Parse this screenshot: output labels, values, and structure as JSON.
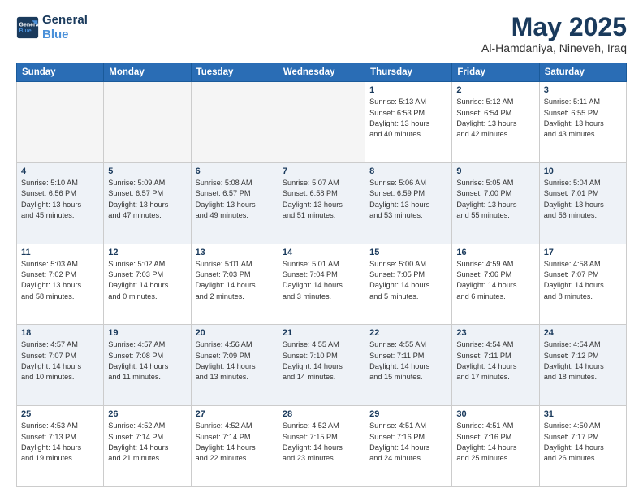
{
  "logo": {
    "line1": "General",
    "line2": "Blue"
  },
  "title": "May 2025",
  "subtitle": "Al-Hamdaniya, Nineveh, Iraq",
  "weekdays": [
    "Sunday",
    "Monday",
    "Tuesday",
    "Wednesday",
    "Thursday",
    "Friday",
    "Saturday"
  ],
  "rows": [
    [
      {
        "day": "",
        "info": ""
      },
      {
        "day": "",
        "info": ""
      },
      {
        "day": "",
        "info": ""
      },
      {
        "day": "",
        "info": ""
      },
      {
        "day": "1",
        "info": "Sunrise: 5:13 AM\nSunset: 6:53 PM\nDaylight: 13 hours\nand 40 minutes."
      },
      {
        "day": "2",
        "info": "Sunrise: 5:12 AM\nSunset: 6:54 PM\nDaylight: 13 hours\nand 42 minutes."
      },
      {
        "day": "3",
        "info": "Sunrise: 5:11 AM\nSunset: 6:55 PM\nDaylight: 13 hours\nand 43 minutes."
      }
    ],
    [
      {
        "day": "4",
        "info": "Sunrise: 5:10 AM\nSunset: 6:56 PM\nDaylight: 13 hours\nand 45 minutes."
      },
      {
        "day": "5",
        "info": "Sunrise: 5:09 AM\nSunset: 6:57 PM\nDaylight: 13 hours\nand 47 minutes."
      },
      {
        "day": "6",
        "info": "Sunrise: 5:08 AM\nSunset: 6:57 PM\nDaylight: 13 hours\nand 49 minutes."
      },
      {
        "day": "7",
        "info": "Sunrise: 5:07 AM\nSunset: 6:58 PM\nDaylight: 13 hours\nand 51 minutes."
      },
      {
        "day": "8",
        "info": "Sunrise: 5:06 AM\nSunset: 6:59 PM\nDaylight: 13 hours\nand 53 minutes."
      },
      {
        "day": "9",
        "info": "Sunrise: 5:05 AM\nSunset: 7:00 PM\nDaylight: 13 hours\nand 55 minutes."
      },
      {
        "day": "10",
        "info": "Sunrise: 5:04 AM\nSunset: 7:01 PM\nDaylight: 13 hours\nand 56 minutes."
      }
    ],
    [
      {
        "day": "11",
        "info": "Sunrise: 5:03 AM\nSunset: 7:02 PM\nDaylight: 13 hours\nand 58 minutes."
      },
      {
        "day": "12",
        "info": "Sunrise: 5:02 AM\nSunset: 7:03 PM\nDaylight: 14 hours\nand 0 minutes."
      },
      {
        "day": "13",
        "info": "Sunrise: 5:01 AM\nSunset: 7:03 PM\nDaylight: 14 hours\nand 2 minutes."
      },
      {
        "day": "14",
        "info": "Sunrise: 5:01 AM\nSunset: 7:04 PM\nDaylight: 14 hours\nand 3 minutes."
      },
      {
        "day": "15",
        "info": "Sunrise: 5:00 AM\nSunset: 7:05 PM\nDaylight: 14 hours\nand 5 minutes."
      },
      {
        "day": "16",
        "info": "Sunrise: 4:59 AM\nSunset: 7:06 PM\nDaylight: 14 hours\nand 6 minutes."
      },
      {
        "day": "17",
        "info": "Sunrise: 4:58 AM\nSunset: 7:07 PM\nDaylight: 14 hours\nand 8 minutes."
      }
    ],
    [
      {
        "day": "18",
        "info": "Sunrise: 4:57 AM\nSunset: 7:07 PM\nDaylight: 14 hours\nand 10 minutes."
      },
      {
        "day": "19",
        "info": "Sunrise: 4:57 AM\nSunset: 7:08 PM\nDaylight: 14 hours\nand 11 minutes."
      },
      {
        "day": "20",
        "info": "Sunrise: 4:56 AM\nSunset: 7:09 PM\nDaylight: 14 hours\nand 13 minutes."
      },
      {
        "day": "21",
        "info": "Sunrise: 4:55 AM\nSunset: 7:10 PM\nDaylight: 14 hours\nand 14 minutes."
      },
      {
        "day": "22",
        "info": "Sunrise: 4:55 AM\nSunset: 7:11 PM\nDaylight: 14 hours\nand 15 minutes."
      },
      {
        "day": "23",
        "info": "Sunrise: 4:54 AM\nSunset: 7:11 PM\nDaylight: 14 hours\nand 17 minutes."
      },
      {
        "day": "24",
        "info": "Sunrise: 4:54 AM\nSunset: 7:12 PM\nDaylight: 14 hours\nand 18 minutes."
      }
    ],
    [
      {
        "day": "25",
        "info": "Sunrise: 4:53 AM\nSunset: 7:13 PM\nDaylight: 14 hours\nand 19 minutes."
      },
      {
        "day": "26",
        "info": "Sunrise: 4:52 AM\nSunset: 7:14 PM\nDaylight: 14 hours\nand 21 minutes."
      },
      {
        "day": "27",
        "info": "Sunrise: 4:52 AM\nSunset: 7:14 PM\nDaylight: 14 hours\nand 22 minutes."
      },
      {
        "day": "28",
        "info": "Sunrise: 4:52 AM\nSunset: 7:15 PM\nDaylight: 14 hours\nand 23 minutes."
      },
      {
        "day": "29",
        "info": "Sunrise: 4:51 AM\nSunset: 7:16 PM\nDaylight: 14 hours\nand 24 minutes."
      },
      {
        "day": "30",
        "info": "Sunrise: 4:51 AM\nSunset: 7:16 PM\nDaylight: 14 hours\nand 25 minutes."
      },
      {
        "day": "31",
        "info": "Sunrise: 4:50 AM\nSunset: 7:17 PM\nDaylight: 14 hours\nand 26 minutes."
      }
    ]
  ]
}
